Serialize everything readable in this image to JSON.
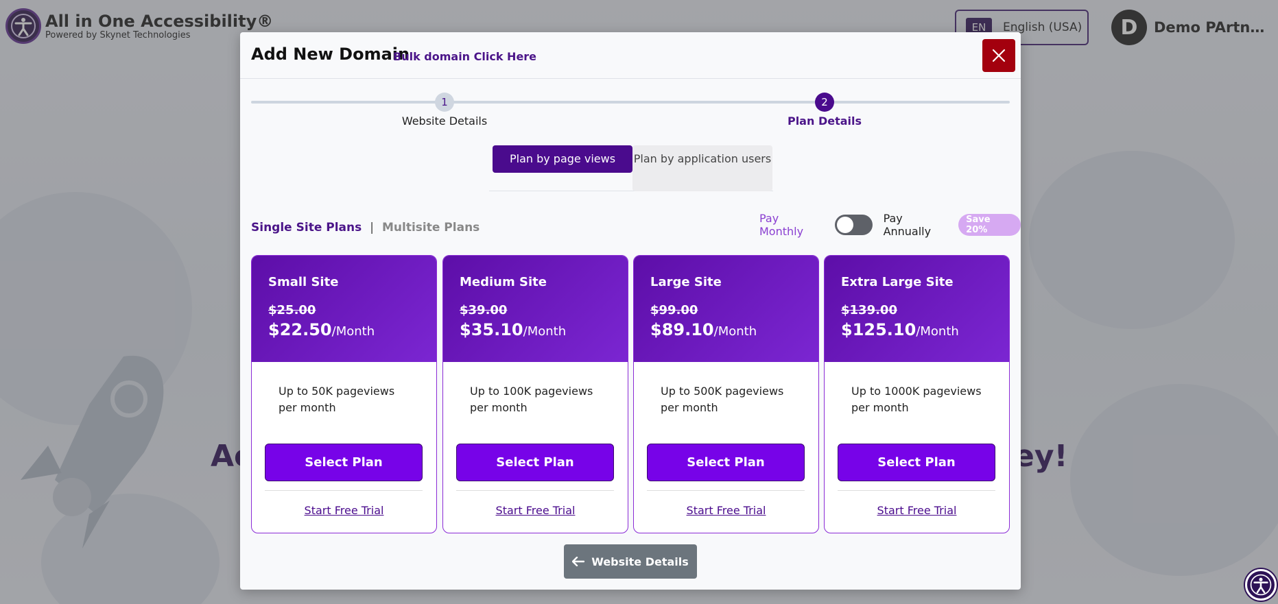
{
  "header": {
    "logo_title": "All in One Accessibility®",
    "logo_subtitle": "Powered by Skynet Technologies",
    "language_code": "EN",
    "language_label": "English (USA)",
    "user_initial": "D",
    "user_name": "Demo PArtn…"
  },
  "background": {
    "headline_left": "Ac",
    "headline_right": "ey!"
  },
  "modal": {
    "title": "Add New Domain",
    "bulk_link": "Bulk domain Click Here",
    "steps": [
      {
        "number": "1",
        "label": "Website Details"
      },
      {
        "number": "2",
        "label": "Plan Details"
      }
    ],
    "tabs": {
      "active": "Plan by page views",
      "inactive": "Plan by application users"
    },
    "plan_groups": {
      "single": "Single Site Plans",
      "separator": "|",
      "multi": "Multisite Plans"
    },
    "billing": {
      "monthly": "Pay Monthly",
      "annually": "Pay Annually",
      "save_badge": "Save 20%",
      "annual_toggle_on": false
    },
    "plans": [
      {
        "name": "Small Site",
        "old_price": "$25.00",
        "price": "$22.50",
        "unit": "/Month",
        "description": "Up to 50K pageviews per month",
        "select_label": "Select Plan",
        "trial_label": "Start Free Trial"
      },
      {
        "name": "Medium Site",
        "old_price": "$39.00",
        "price": "$35.10",
        "unit": "/Month",
        "description": "Up to 100K pageviews per month",
        "select_label": "Select Plan",
        "trial_label": "Start Free Trial"
      },
      {
        "name": "Large Site",
        "old_price": "$99.00",
        "price": "$89.10",
        "unit": "/Month",
        "description": "Up to 500K pageviews per month",
        "select_label": "Select Plan",
        "trial_label": "Start Free Trial"
      },
      {
        "name": "Extra Large Site",
        "old_price": "$139.00",
        "price": "$125.10",
        "unit": "/Month",
        "description": "Up to 1000K pageviews per month",
        "select_label": "Select Plan",
        "trial_label": "Start Free Trial"
      }
    ],
    "back_button": "Website Details"
  },
  "colors": {
    "brand_purple": "#4a0b8d",
    "button_purple": "#7703e8",
    "close_red": "#a3000e",
    "back_gray": "#6c757d"
  },
  "icons": {
    "close": "close-icon",
    "back": "arrow-left-icon",
    "accessibility": "accessibility-icon"
  }
}
